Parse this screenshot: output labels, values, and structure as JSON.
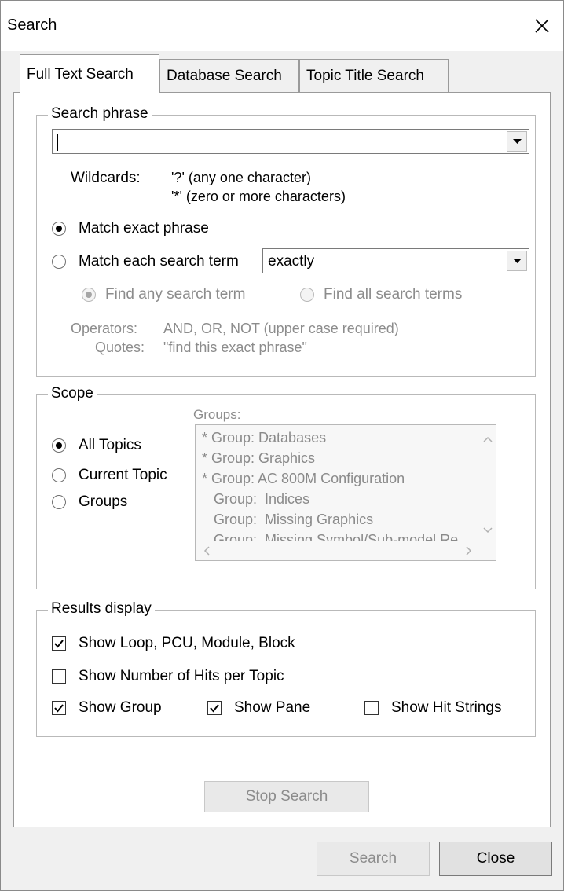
{
  "window": {
    "title": "Search"
  },
  "tabs": [
    {
      "label": "Full Text Search",
      "active": true
    },
    {
      "label": "Database Search",
      "active": false
    },
    {
      "label": "Topic Title Search",
      "active": false
    }
  ],
  "search_phrase": {
    "legend": "Search phrase",
    "input_value": "",
    "wildcards_label": "Wildcards:",
    "wildcard_q": "'?' (any one character)",
    "wildcard_star": "'*' (zero or more characters)",
    "match_exact": "Match exact phrase",
    "match_each": "Match each search term",
    "match_mode_value": "exactly",
    "find_any": "Find any search term",
    "find_all": "Find all search terms",
    "operators_label": "Operators:",
    "operators_value": "AND, OR, NOT (upper case required)",
    "quotes_label": "Quotes:",
    "quotes_value": "\"find this exact phrase\""
  },
  "scope": {
    "legend": "Scope",
    "all_topics": "All Topics",
    "current_topic": "Current Topic",
    "groups": "Groups",
    "groups_label": "Groups:",
    "group_list": [
      "* Group:  Databases",
      "* Group:  Graphics",
      "* Group:  AC 800M Configuration",
      "   Group:  Indices",
      "   Group:  Missing Graphics",
      "   Group:  Missing Symbol/Sub-model Re"
    ]
  },
  "results_display": {
    "legend": "Results display",
    "show_loop": "Show Loop, PCU, Module, Block",
    "show_hits": "Show Number of Hits per Topic",
    "show_group": "Show Group",
    "show_pane": "Show Pane",
    "show_hit_strings": "Show Hit Strings"
  },
  "buttons": {
    "stop_search": "Stop Search",
    "search": "Search",
    "close": "Close"
  }
}
